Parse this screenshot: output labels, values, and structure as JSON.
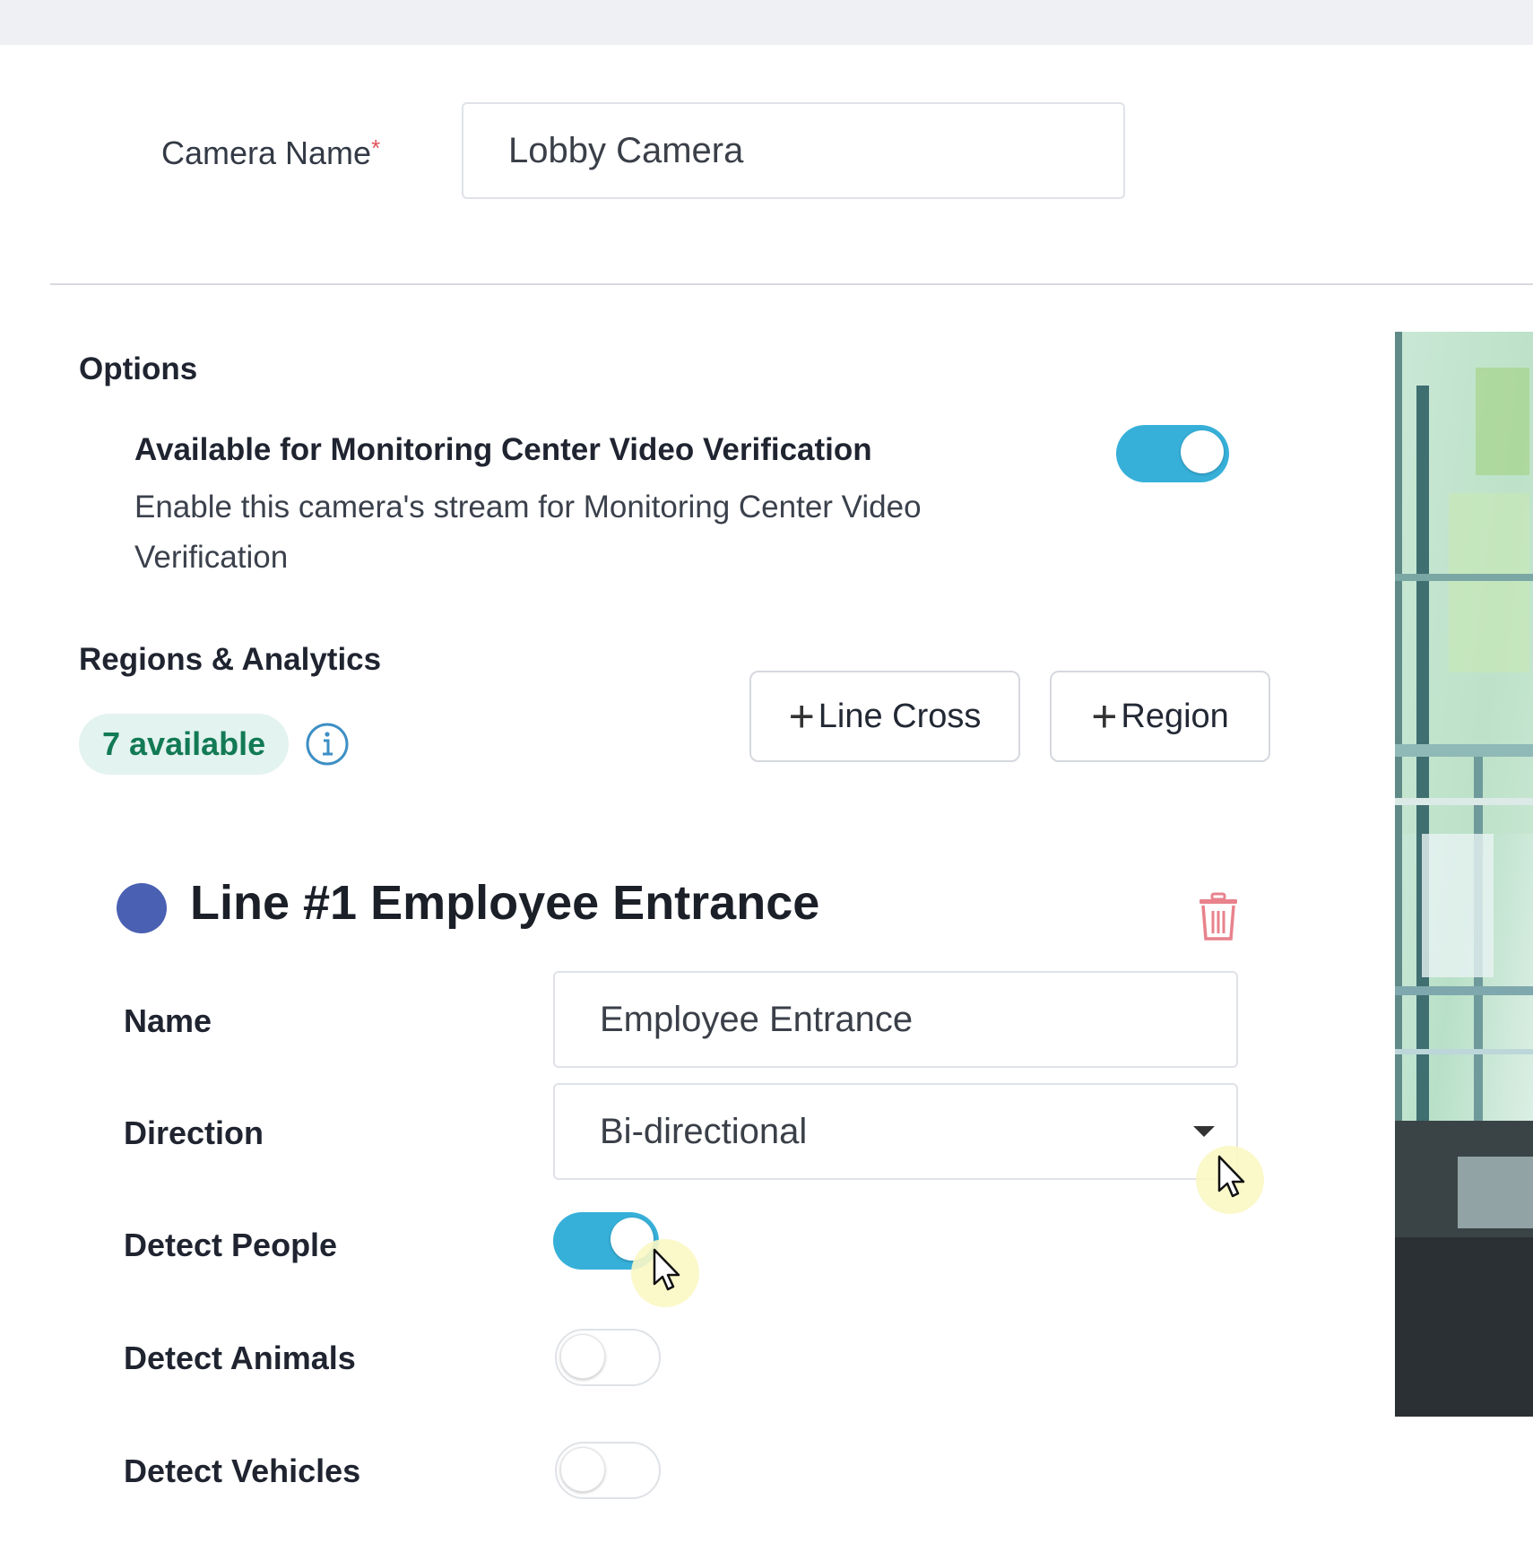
{
  "camera": {
    "name_label": "Camera Name",
    "required_mark": "*",
    "name_value": "Lobby Camera"
  },
  "options": {
    "section_title": "Options",
    "monitoring": {
      "title": "Available for Monitoring Center Video Verification",
      "description": "Enable this camera's stream for Monitoring Center Video Verification",
      "enabled": true
    }
  },
  "regions": {
    "section_title": "Regions & Analytics",
    "available_badge": "7 available",
    "info_icon": "info-circle-icon",
    "add_line_cross_label": "Line Cross",
    "add_region_label": "Region",
    "plus_glyph": "+"
  },
  "line": {
    "title": "Line #1 Employee Entrance",
    "dot_color": "#4a60b3",
    "delete_icon": "trash-icon",
    "fields": {
      "name_label": "Name",
      "name_value": "Employee Entrance",
      "direction_label": "Direction",
      "direction_value": "Bi-directional",
      "detect_people_label": "Detect People",
      "detect_people": true,
      "detect_animals_label": "Detect Animals",
      "detect_animals": false,
      "detect_vehicles_label": "Detect Vehicles",
      "detect_vehicles": false
    }
  },
  "colors": {
    "toggle_on": "#37b0d9",
    "badge_bg": "#e3f3ef",
    "badge_text": "#127a55",
    "delete": "#e8828c",
    "info": "#3d8fc4"
  }
}
